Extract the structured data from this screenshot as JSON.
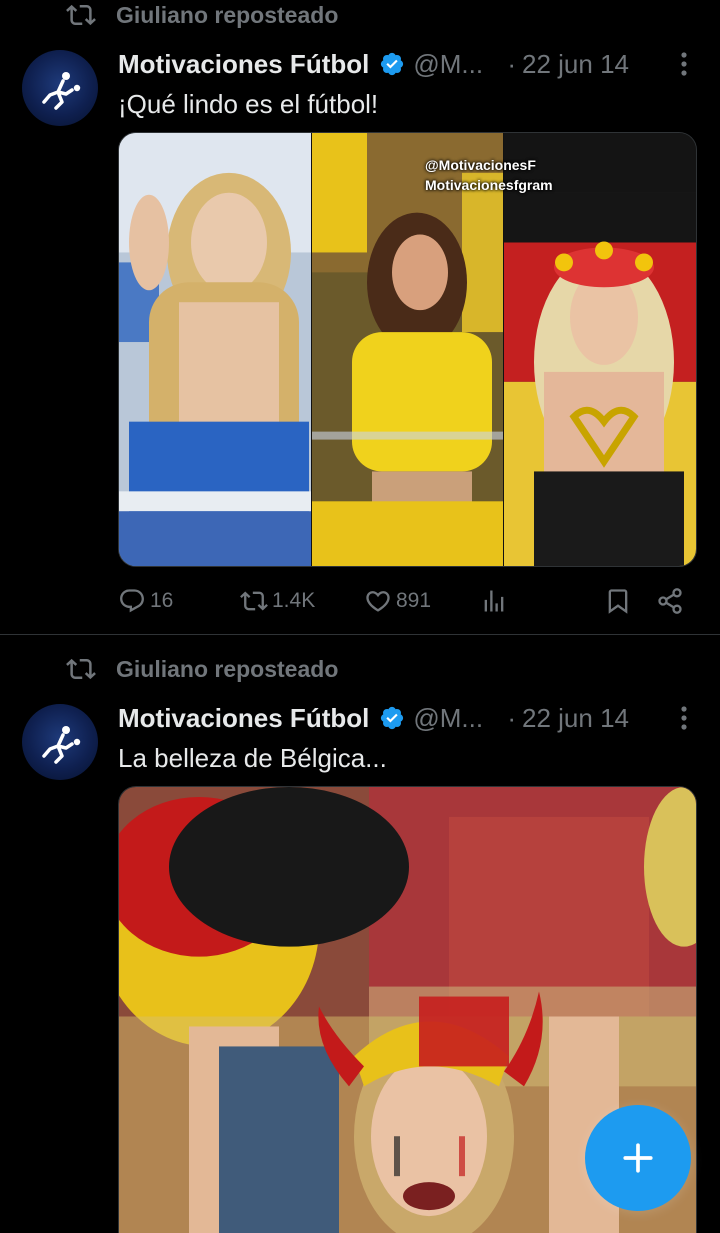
{
  "tweets": [
    {
      "repost_label": "Giuliano reposteado",
      "author_name": "Motivaciones Fútbol",
      "handle": "@M...",
      "separator": "·",
      "date": "22 jun 14",
      "text": "¡Qué lindo es el fútbol!",
      "media_watermark_line1": "@MotivacionesF",
      "media_watermark_line2": "Motivacionesfgram",
      "replies": "16",
      "reposts": "1.4K",
      "likes": "891"
    },
    {
      "repost_label": "Giuliano reposteado",
      "author_name": "Motivaciones Fútbol",
      "handle": "@M...",
      "separator": "·",
      "date": "22 jun 14",
      "text": "La belleza de Bélgica..."
    }
  ],
  "icons": {
    "repost": "repost-icon",
    "verified": "verified-badge-icon",
    "more": "more-options-icon",
    "reply": "reply-icon",
    "like": "like-icon",
    "views": "views-icon",
    "bookmark": "bookmark-icon",
    "share": "share-icon",
    "compose": "plus-icon"
  },
  "colors": {
    "background": "#000000",
    "text_primary": "#e7e9ea",
    "text_secondary": "#71767b",
    "accent": "#1d9bf0",
    "divider": "#2f3336"
  }
}
